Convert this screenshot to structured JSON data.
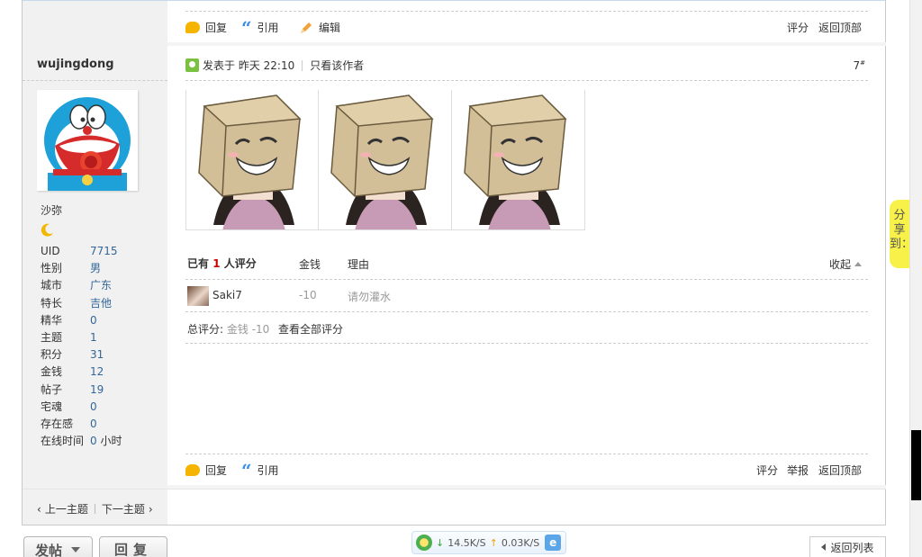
{
  "top_bar": {
    "reply_label": "回复",
    "quote_label": "引用",
    "edit_label": "编辑",
    "rate_label": "评分",
    "back_top_label": "返回顶部"
  },
  "author": {
    "username": "wujingdong",
    "rank": "沙弥",
    "stats": [
      {
        "key": "UID",
        "value": "7715"
      },
      {
        "key": "性别",
        "value": "男"
      },
      {
        "key": "城市",
        "value": "广东"
      },
      {
        "key": "特长",
        "value": "吉他"
      },
      {
        "key": "精华",
        "value": "0"
      },
      {
        "key": "主题",
        "value": "1"
      },
      {
        "key": "积分",
        "value": "31"
      },
      {
        "key": "金钱",
        "value": "12"
      },
      {
        "key": "帖子",
        "value": "19"
      },
      {
        "key": "宅魂",
        "value": "0"
      },
      {
        "key": "存在感",
        "value": "0"
      },
      {
        "key": "在线时间",
        "value": "0",
        "suffix": "小时"
      }
    ]
  },
  "post": {
    "posted_label": "发表于 昨天 22:10",
    "only_author_label": "只看该作者",
    "floor_number": "7",
    "floor_sup": "#"
  },
  "rating": {
    "head_prefix": "已有",
    "head_count": "1",
    "head_suffix": "人评分",
    "col_money": "金钱",
    "col_reason": "理由",
    "collapse_label": "收起",
    "rows": [
      {
        "name": "Saki7",
        "money": "-10",
        "reason": "请勿灌水"
      }
    ],
    "total_prefix": "总评分:",
    "total_value": "金钱 -10",
    "view_all_label": "查看全部评分"
  },
  "bottom_bar": {
    "reply_label": "回复",
    "quote_label": "引用",
    "rate_label": "评分",
    "report_label": "举报",
    "back_top_label": "返回顶部"
  },
  "thread_nav": {
    "prev_label": "上一主题",
    "next_label": "下一主题"
  },
  "share_tab": {
    "label": "分享到："
  },
  "footer": {
    "post_button": "发帖",
    "reply_button": "回复",
    "download_speed": "14.5K/S",
    "upload_speed": "0.03K/S",
    "back_list": "返回列表"
  }
}
